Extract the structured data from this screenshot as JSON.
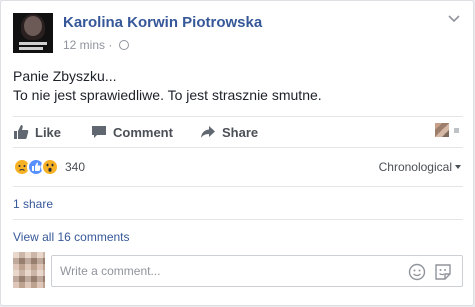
{
  "post": {
    "author": "Karolina Korwin Piotrowska",
    "timestamp": "12 mins",
    "separator": "·",
    "lines": [
      "Panie Zbyszku...",
      "To nie jest sprawiedliwe. To jest strasznie smutne."
    ]
  },
  "actions": {
    "like": "Like",
    "comment": "Comment",
    "share": "Share"
  },
  "reactions": {
    "count": "340",
    "types": [
      "sad-reaction",
      "like-reaction",
      "wow-reaction"
    ]
  },
  "sort": {
    "label": "Chronological"
  },
  "shares": {
    "label": "1 share"
  },
  "comments": {
    "view_all": "View all 16 comments",
    "placeholder": "Write a comment..."
  },
  "colors": {
    "link": "#365899",
    "secondary": "#90949c",
    "action": "#4b4f56"
  }
}
